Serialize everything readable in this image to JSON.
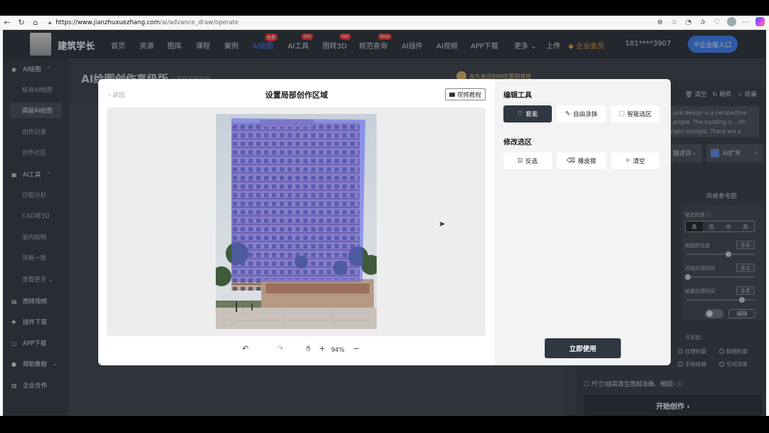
{
  "browser": {
    "url_host": "https://www.jianzhuxuezhang.com",
    "url_path": "/ai/advance_draw/operate"
  },
  "site": {
    "logo_text": "建筑学长",
    "nav": [
      {
        "label": "首页"
      },
      {
        "label": "资源"
      },
      {
        "label": "图库"
      },
      {
        "label": "课程"
      },
      {
        "label": "案例"
      },
      {
        "label": "AI绘图",
        "badge": "免费"
      },
      {
        "label": "AI工具",
        "badge": "Hot"
      },
      {
        "label": "图转3D",
        "badge": "Hot"
      },
      {
        "label": "规范查询",
        "badge": "New"
      },
      {
        "label": "AI插件"
      },
      {
        "label": "AI视频"
      },
      {
        "label": "APP下载"
      },
      {
        "label": "更多 ⌄"
      },
      {
        "label": "上传"
      }
    ],
    "member": "企业会员",
    "phone": "181****3907",
    "enterprise_btn": "企业版入口"
  },
  "sidebar": {
    "ai_draw": "AI绘图",
    "draw_items": [
      "标准AI绘图",
      "高级AI绘图",
      "创作记录",
      "创作社区"
    ],
    "ai_tools": "AI工具",
    "tool_items": [
      "日照分析",
      "CAD转3D",
      "室内照明",
      "风格一致",
      "查看更多 ⌄"
    ],
    "video": "图转视频",
    "plugin": "插件下载",
    "app": "APP下载",
    "help": "帮助教程",
    "enterprise": "企业合作"
  },
  "page": {
    "title": "AI绘图创作高级版",
    "subtitle": "让灵感无限延伸",
    "vip": "永久会员899优惠即将结"
  },
  "right_panel": {
    "tools": [
      "清空",
      "随机",
      "收藏"
    ],
    "prompt_text": "...ural design is a perspective ...ample. The building is ...ith bright sunlight. There are a",
    "btn_desc": "描述词 ›",
    "btn_expand": "AI扩写",
    "style_ref": "风格参考图",
    "lock_material": "锁定材质 ⓘ",
    "seg": [
      "关",
      "低",
      "中",
      "高"
    ],
    "base_match": "底图符合度",
    "base_match_val": "0.6",
    "start_time": "开始应用时间",
    "start_val": "0.0",
    "end_time": "结束应用时间",
    "end_val": "0.8",
    "edit": "编辑",
    "multi": "可多选)",
    "opts": [
      "纹理轮廓",
      "精细轮廓",
      "手绘线稿",
      "空间深度"
    ],
    "size": "尺寸(越高清生图越准确、细腻) ⓘ",
    "start_btn": "开始创作 ›"
  },
  "modal": {
    "back": "返回",
    "title": "设置局部创作区域",
    "tutorial": "视频教程",
    "zoom": "94%",
    "edit_tools_title": "编辑工具",
    "tools": [
      {
        "label": "套索",
        "icon": "♡"
      },
      {
        "label": "自由涂抹",
        "icon": "✎"
      },
      {
        "label": "智能选区",
        "icon": "⬚"
      }
    ],
    "modify_title": "修改选区",
    "modify": [
      {
        "label": "反选",
        "icon": "⊡"
      },
      {
        "label": "橡皮擦",
        "icon": "⌫"
      },
      {
        "label": "清空",
        "icon": "✧"
      }
    ],
    "apply": "立即使用"
  },
  "colors": {
    "accent": "#3d7ef0",
    "mask": "#5a5cf0",
    "dark_btn": "#2f3740"
  }
}
